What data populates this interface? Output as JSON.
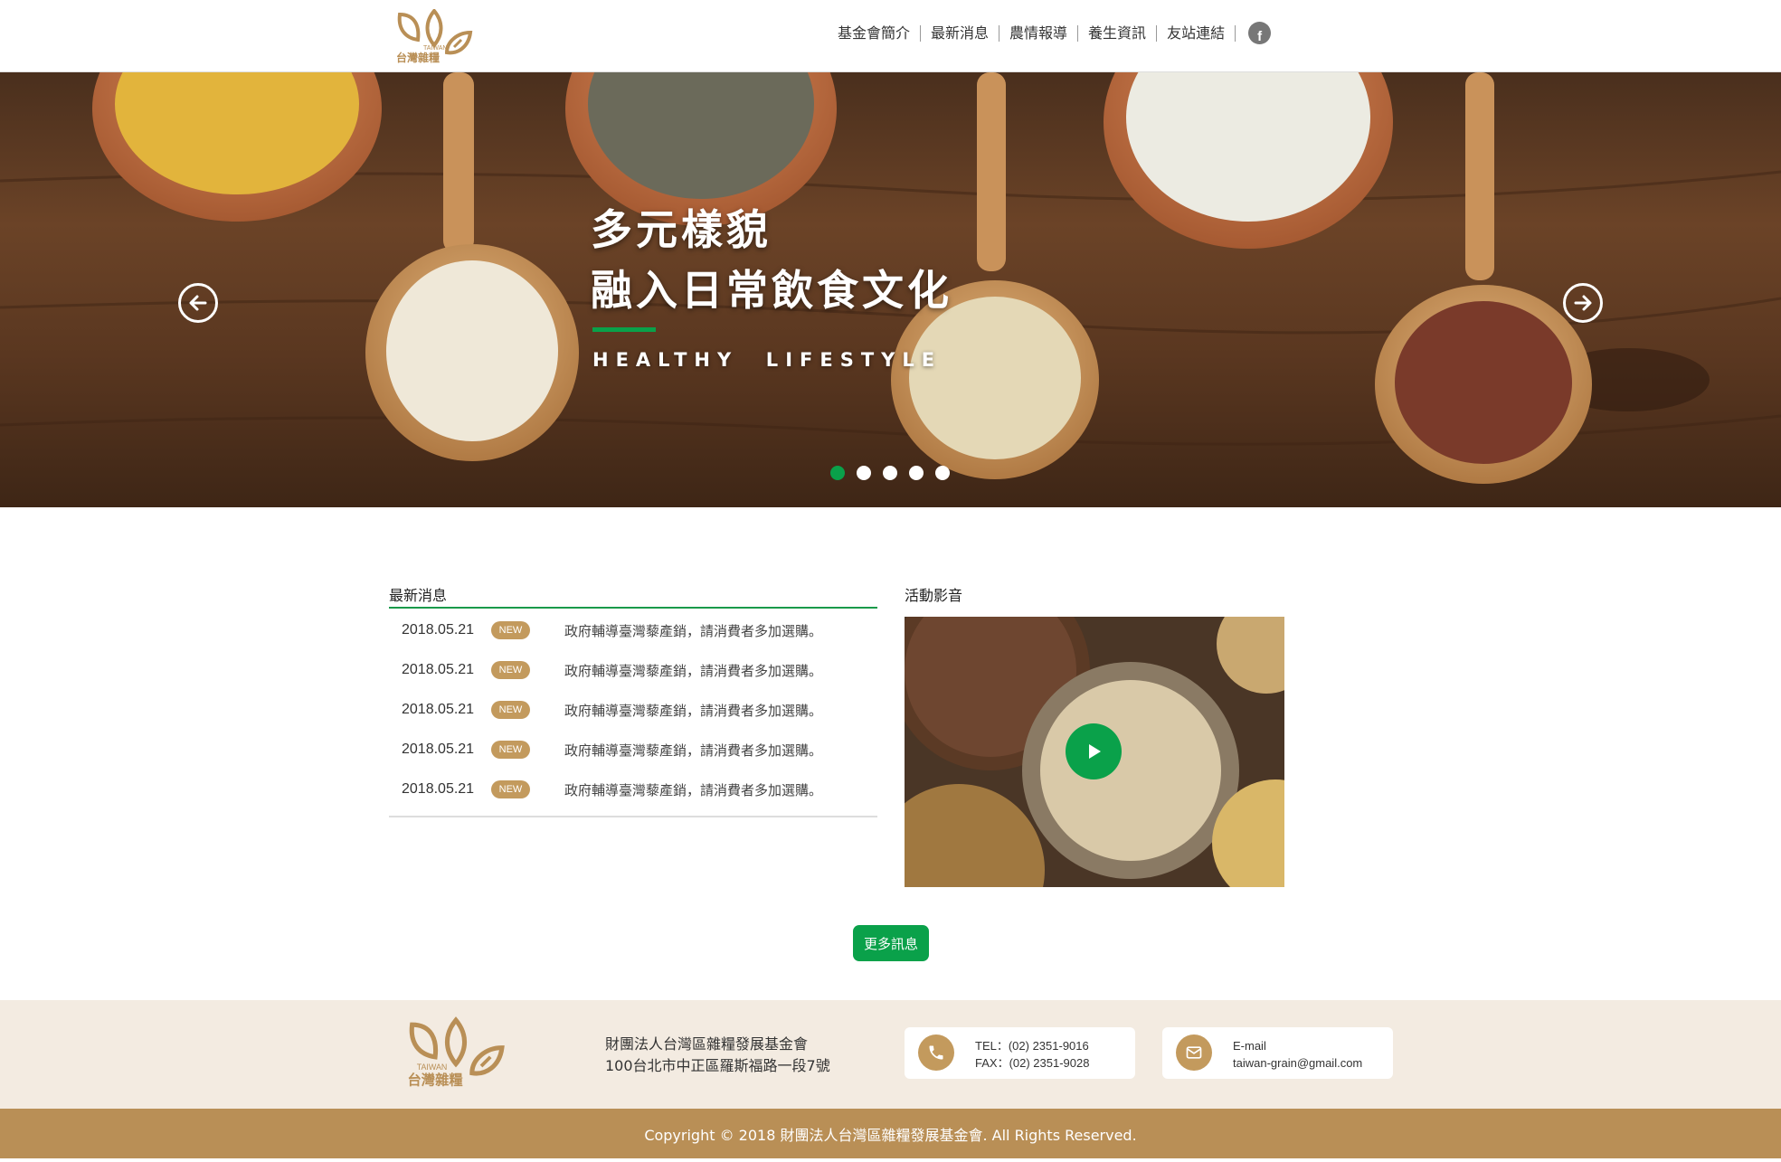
{
  "brand": {
    "logo_text_en": "TAIWAN",
    "logo_text_zh": "台灣雜糧"
  },
  "nav": {
    "items": [
      {
        "label": "基金會簡介"
      },
      {
        "label": "最新消息"
      },
      {
        "label": "農情報導"
      },
      {
        "label": "養生資訊"
      },
      {
        "label": "友站連結"
      }
    ],
    "facebook_icon": "facebook-icon"
  },
  "hero": {
    "title_line1": "多元樣貌",
    "title_line2": "融入日常飲食文化",
    "subtitle": "HEALTHY  LIFESTYLE",
    "slide_count": 5,
    "active_slide": 1
  },
  "news": {
    "heading": "最新消息",
    "badge": "NEW",
    "items": [
      {
        "date": "2018.05.21",
        "text": "政府輔導臺灣藜產銷，請消費者多加選購。"
      },
      {
        "date": "2018.05.21",
        "text": "政府輔導臺灣藜產銷，請消費者多加選購。"
      },
      {
        "date": "2018.05.21",
        "text": "政府輔導臺灣藜產銷，請消費者多加選購。"
      },
      {
        "date": "2018.05.21",
        "text": "政府輔導臺灣藜產銷，請消費者多加選購。"
      },
      {
        "date": "2018.05.21",
        "text": "政府輔導臺灣藜產銷，請消費者多加選購。"
      }
    ]
  },
  "video": {
    "heading": "活動影音",
    "play_icon": "play-icon"
  },
  "more_button": "更多訊息",
  "footer": {
    "org_name": "財團法人台灣區雜糧發展基金會",
    "address": "100台北市中正區羅斯福路一段7號",
    "tel": "TEL：(02) 2351-9016",
    "fax": "FAX：(02) 2351-9028",
    "email_label": "E-mail",
    "email": "taiwan-grain@gmail.com",
    "copyright": "Copyright © 2018 財團法人台灣區雜糧發展基金會. All Rights Reserved."
  },
  "colors": {
    "accent_green": "#0aa14a",
    "brand_gold": "#c39a5d",
    "footer_bg": "#f3ebe1",
    "copyright_bg": "#b98f56"
  }
}
